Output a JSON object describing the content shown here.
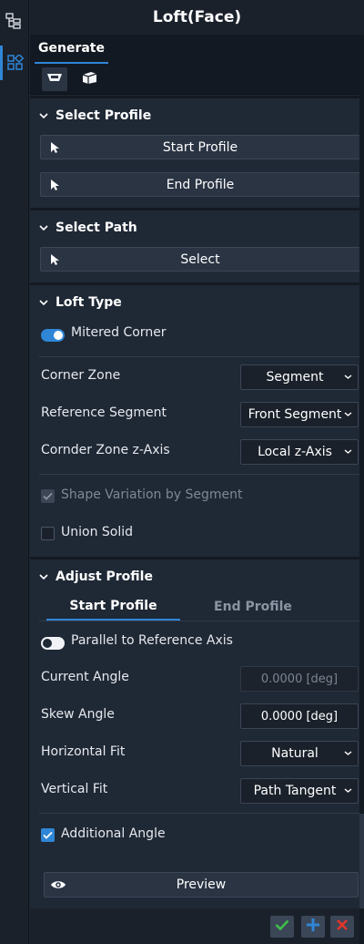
{
  "window": {
    "title": "Loft(Face)"
  },
  "rail": {
    "items": [
      {
        "icon": "tree-icon",
        "active": false
      },
      {
        "icon": "grid-icon",
        "active": true
      }
    ]
  },
  "tabs": {
    "generate": "Generate"
  },
  "select_profile": {
    "title": "Select Profile",
    "start_button": "Start Profile",
    "end_button": "End Profile"
  },
  "select_path": {
    "title": "Select Path",
    "select_button": "Select"
  },
  "loft_type": {
    "title": "Loft Type",
    "mitered_corner": {
      "label": "Mitered Corner",
      "on": true
    },
    "corner_zone": {
      "label": "Corner Zone",
      "value": "Segment"
    },
    "reference_segment": {
      "label": "Reference Segment",
      "value": "Front Segment"
    },
    "corner_zone_axis": {
      "label": "Cornder Zone z-Axis",
      "value": "Local z-Axis"
    },
    "shape_variation": {
      "label": "Shape Variation by Segment",
      "checked": true,
      "disabled": true
    },
    "union_solid": {
      "label": "Union Solid",
      "checked": false
    }
  },
  "adjust_profile": {
    "title": "Adjust Profile",
    "tabs": [
      "Start Profile",
      "End Profile"
    ],
    "parallel": {
      "label": "Parallel to Reference Axis",
      "on": false
    },
    "current_angle": {
      "label": "Current Angle",
      "value": "0.0000 [deg]"
    },
    "skew_angle": {
      "label": "Skew Angle",
      "value": "0.0000 [deg]"
    },
    "horizontal_fit": {
      "label": "Horizontal Fit",
      "value": "Natural"
    },
    "vertical_fit": {
      "label": "Vertical Fit",
      "value": "Path Tangent"
    },
    "additional_angle": {
      "label": "Additional Angle",
      "checked": true
    }
  },
  "preview_button": "Preview",
  "colors": {
    "accent": "#2f86d6",
    "ok": "#3fbf4a",
    "add": "#2f86d6",
    "cancel": "#e0352b",
    "panel": "#1f2835"
  }
}
